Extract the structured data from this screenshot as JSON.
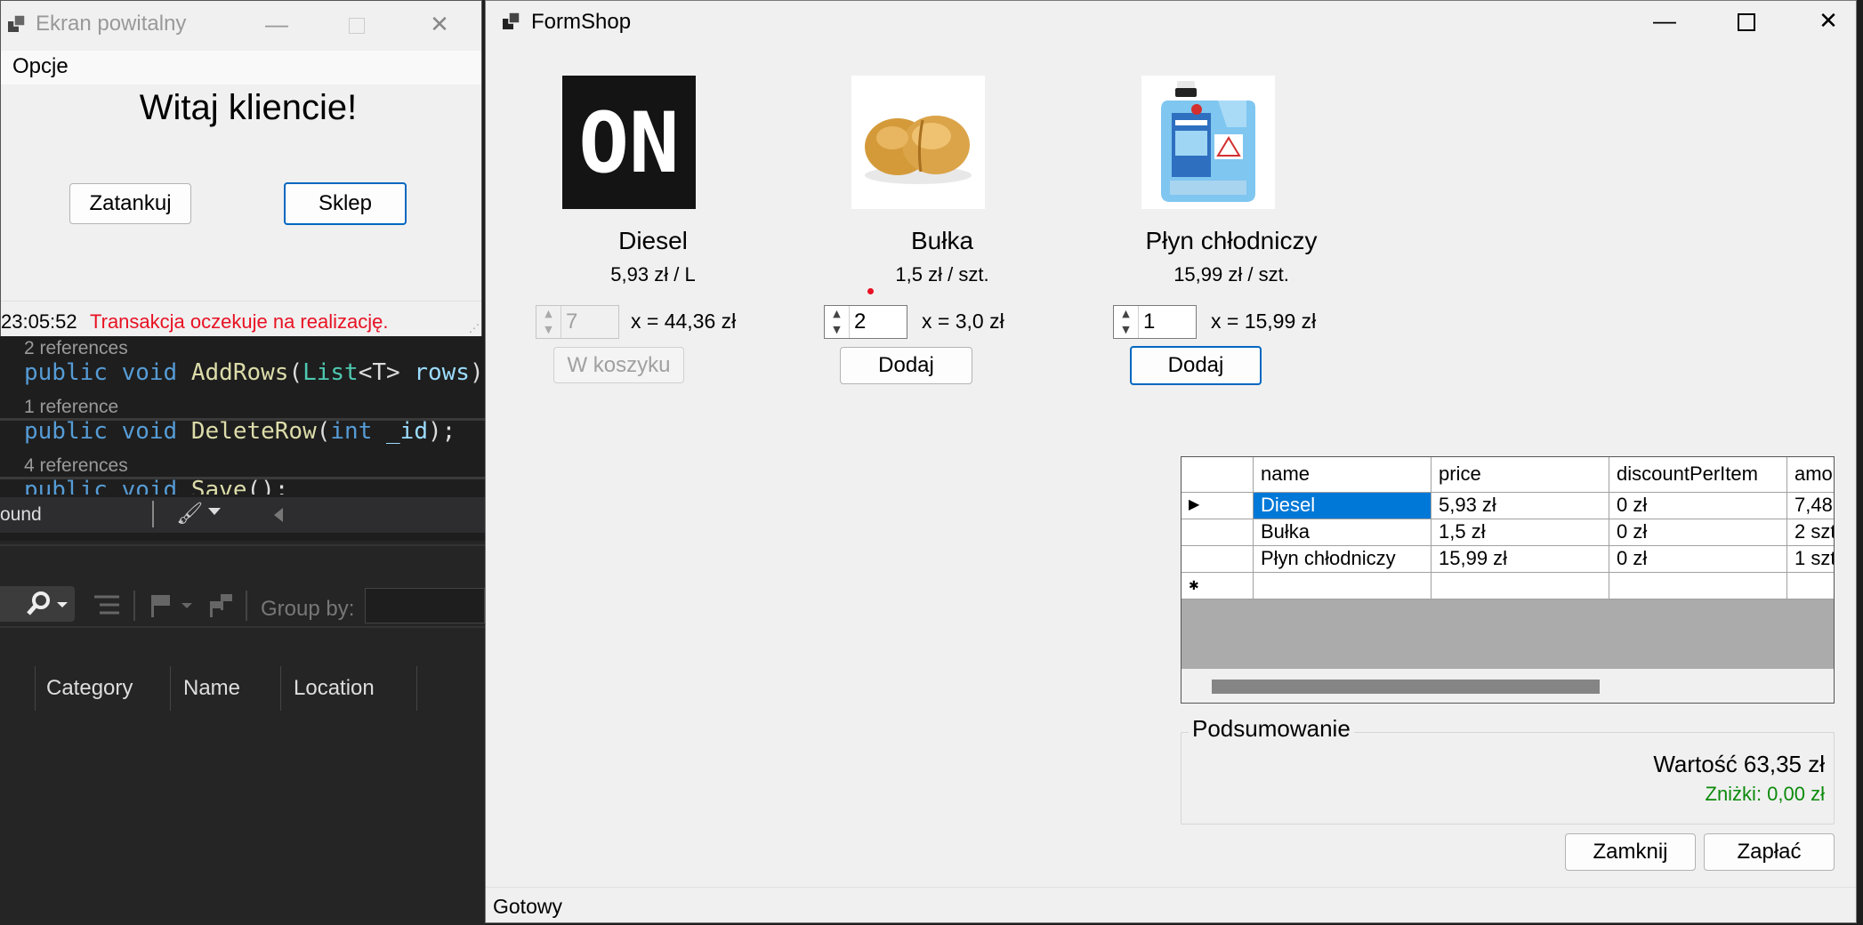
{
  "ide": {
    "references": [
      "2 references",
      "1 reference",
      "4 references"
    ],
    "code": {
      "line1": {
        "kw1": "public",
        "kw2": "void",
        "fn": "AddRows",
        "ty": "List",
        "tparam": "<T>",
        "param": "rows",
        "tail": ")"
      },
      "line2": {
        "kw1": "public",
        "kw2": "void",
        "fn": "DeleteRow",
        "paren": "(",
        "ptype": "int",
        "param": "_id",
        "tail": ");"
      },
      "line3": {
        "kw1": "public",
        "kw2": "void",
        "fn": "Save",
        "tail": "();"
      }
    },
    "toolbar_text": "ound",
    "group_by_label": "Group by:",
    "columns": [
      "Category",
      "Name",
      "Location"
    ]
  },
  "welcome": {
    "title": "Ekran powitalny",
    "menu": "Opcje",
    "heading": "Witaj kliencie!",
    "btn_tank": "Zatankuj",
    "btn_shop": "Sklep",
    "status_time": "23:05:52",
    "status_message": "Transakcja oczekuje na realizację."
  },
  "shop": {
    "title": "FormShop",
    "products": [
      {
        "name": "Diesel",
        "price": "5,93 zł / L",
        "qty": "7",
        "total": "x = 44,36 zł",
        "button": "W koszyku",
        "image": "on-fuel-logo"
      },
      {
        "name": "Bułka",
        "price": "1,5 zł / szt.",
        "qty": "2",
        "total": "x = 3,0 zł",
        "button": "Dodaj",
        "image": "bread-roll"
      },
      {
        "name": "Płyn chłodniczy",
        "price": "15,99 zł / szt.",
        "qty": "1",
        "total": "x = 15,99 zł",
        "button": "Dodaj",
        "image": "coolant-canister"
      }
    ],
    "on_logo_text": "ON",
    "grid": {
      "columns": [
        "name",
        "price",
        "discountPerItem",
        "amo"
      ],
      "rows": [
        [
          "Diesel",
          "5,93 zł",
          "0 zł",
          "7,48"
        ],
        [
          "Bułka",
          "1,5 zł",
          "0 zł",
          "2 szt"
        ],
        [
          "Płyn chłodniczy",
          "15,99 zł",
          "0 zł",
          "1 szt"
        ]
      ]
    },
    "summary": {
      "title": "Podsumowanie",
      "value": "Wartość 63,35 zł",
      "discount": "Zniżki: 0,00 zł",
      "discount_color": "#0b8a0b"
    },
    "btn_close": "Zamknij",
    "btn_pay": "Zapłać",
    "status": "Gotowy"
  },
  "colors": {
    "accent": "#0067c0",
    "selection": "#0078d7",
    "error": "#e81123"
  }
}
